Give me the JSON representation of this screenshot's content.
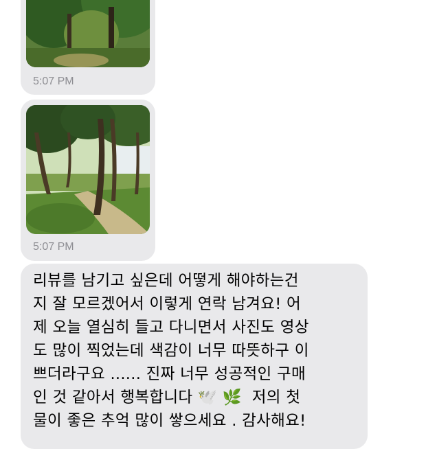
{
  "conversation": {
    "messages": [
      {
        "kind": "photo",
        "description_icon": "forest-photo-icon",
        "timestamp": "5:07 PM"
      },
      {
        "kind": "photo",
        "description_icon": "forest-path-photo-icon",
        "timestamp": "5:07 PM"
      },
      {
        "kind": "text",
        "lines": [
          "리뷰를 남기고 싶은데 어떻게 해야하는건",
          "지 잘 모르겠어서 이렇게 연락 남겨요! 어",
          "제 오늘 열심히 들고 다니면서 사진도 영상",
          "도 많이 찍었는데 색감이 너무 따뜻하구 이",
          "쁘더라구요 ...... 진짜 너무 성공적인 구매",
          "인 것 같아서 행복합니다 🕊️ 🌿  저의 첫",
          "물이 좋은 추억 많이 쌓으세요 . 감사해요!"
        ]
      }
    ]
  },
  "colors": {
    "bubble": "#e9e9eb",
    "timestamp": "#8e8e93",
    "text": "#000000"
  }
}
